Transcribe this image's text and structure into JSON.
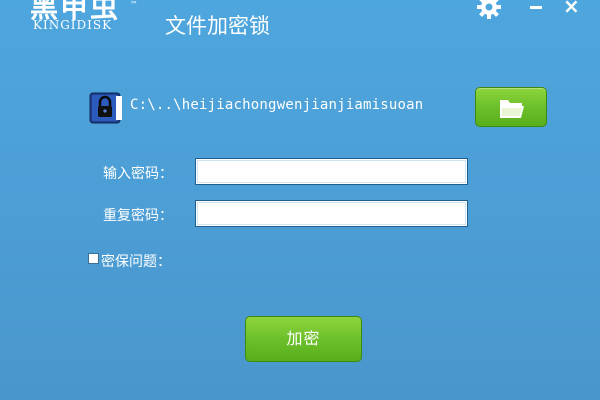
{
  "header": {
    "logo_cn": "黑甲虫",
    "logo_en": "KINGIDISK",
    "trademark": "™",
    "title": "文件加密锁"
  },
  "window_controls": {
    "settings_icon": "gear-icon",
    "minimize_icon": "minimize-icon",
    "close_glyph": "×"
  },
  "file": {
    "icon": "lock-icon",
    "path": "C:\\..\\heijiachongwenjianjiamisuoan",
    "browse_icon": "folder-open-icon"
  },
  "form": {
    "password_label": "输入密码：",
    "password_value": "",
    "confirm_label": "重复密码：",
    "confirm_value": "",
    "security_question_label": "密保问题：",
    "security_question_checked": false
  },
  "actions": {
    "encrypt_label": "加密"
  },
  "colors": {
    "background": "#4ca2d9",
    "button_green": "#6cc02a",
    "text": "#ffffff"
  }
}
